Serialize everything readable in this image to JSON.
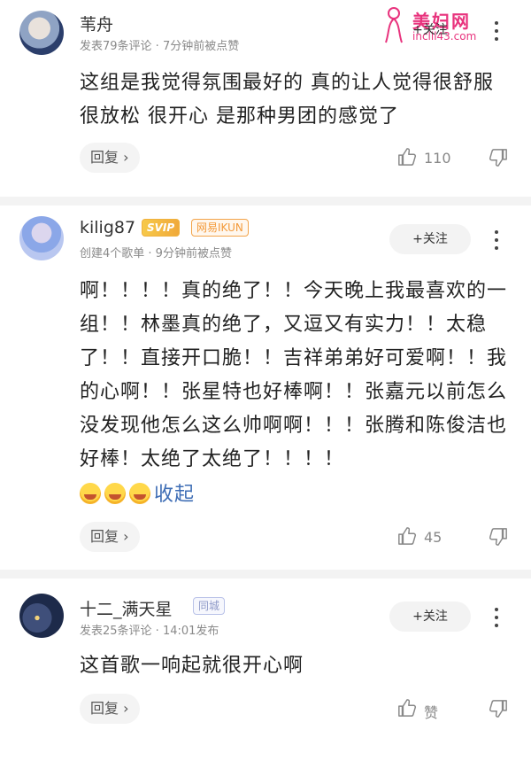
{
  "watermark": {
    "title": "美妇网",
    "url": "inclil43.com"
  },
  "comments": [
    {
      "username": "苇舟",
      "meta": "发表79条评论 · 7分钟前被点赞",
      "follow_label": "+关注",
      "text": "这组是我觉得氛围最好的 真的让人觉得很舒服 很放松 很开心 是那种男团的感觉了",
      "reply_label": "回复 ›",
      "likes": "110"
    },
    {
      "username": "kilig87",
      "badges": [
        "SVIP",
        "网易IKUN"
      ],
      "meta": "创建4个歌单 · 9分钟前被点赞",
      "follow_label": "+关注",
      "text": "啊！！！！真的绝了！！今天晚上我最喜欢的一组！！林墨真的绝了，又逗又有实力！！太稳了！！直接开口脆！！吉祥弟弟好可爱啊！！我的心啊！！张星特也好棒啊！！张嘉元以前怎么没发现他怎么这么帅啊啊！！！张腾和陈俊洁也好棒！太绝了太绝了！！！！",
      "collapse_label": "收起",
      "reply_label": "回复 ›",
      "likes": "45"
    },
    {
      "username": "十二_满天星",
      "badges": [
        "同城"
      ],
      "meta": "发表25条评论 · 14:01发布",
      "follow_label": "+关注",
      "text": "这首歌一响起就很开心啊",
      "reply_label": "回复 ›",
      "likes": "赞"
    }
  ],
  "icons": {
    "like": "thumbs-up-icon",
    "dislike": "thumbs-down-icon",
    "more": "more-vertical-icon"
  },
  "colors": {
    "accent_link": "#3e6db5",
    "watermark": "#e8337d",
    "svip": "#f0a93a"
  }
}
